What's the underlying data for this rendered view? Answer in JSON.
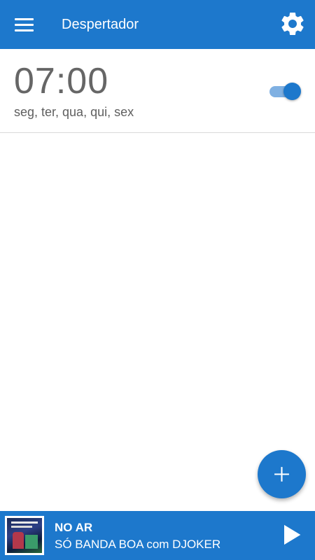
{
  "toolbar": {
    "title": "Despertador",
    "menu_icon": "hamburger-menu-icon",
    "settings_icon": "gear-icon",
    "background": "#1d78cc"
  },
  "alarms": [
    {
      "time": "07:00",
      "days": "seg, ter, qua, qui, sex",
      "enabled": true
    }
  ],
  "fab": {
    "icon": "plus-icon"
  },
  "player": {
    "status": "NO AR",
    "program": "SÓ BANDA BOA com DJOKER",
    "play_icon": "play-icon",
    "cover_icon": "album-cover-image",
    "background": "#1d78cc"
  },
  "colors": {
    "accent": "#1d78cc",
    "toggle_track": "#7fb0e2"
  }
}
